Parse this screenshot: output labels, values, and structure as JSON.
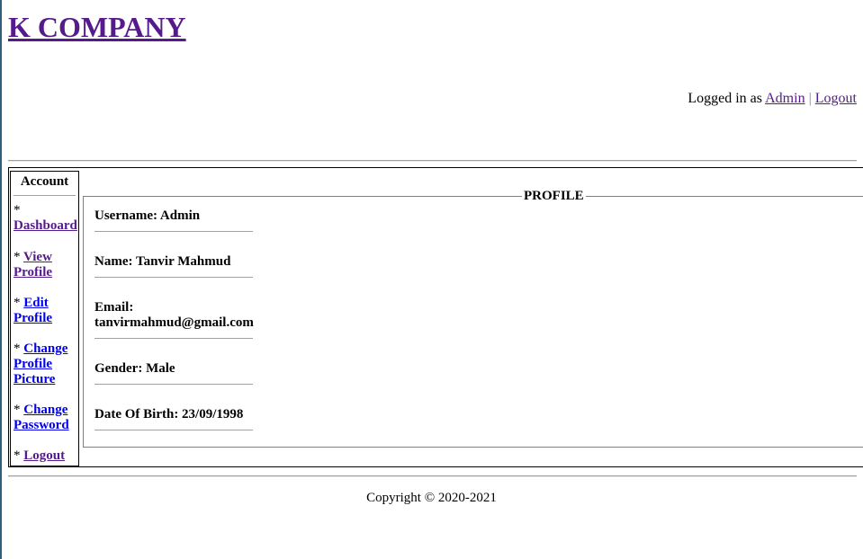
{
  "header": {
    "brand": "K COMPANY",
    "logged_in_prefix": "Logged in as",
    "user_link": "Admin",
    "separator": "|",
    "logout_link": "Logout"
  },
  "sidebar": {
    "title": "Account",
    "bullet": "*",
    "items": [
      {
        "label": "Dashboard"
      },
      {
        "label": "View Profile"
      },
      {
        "label": "Edit Profile"
      },
      {
        "label": "Change Profile Picture"
      },
      {
        "label": "Change Password"
      },
      {
        "label": "Logout"
      }
    ]
  },
  "profile": {
    "legend": "PROFILE",
    "fields": [
      {
        "text": "Username: Admin"
      },
      {
        "text": "Name: Tanvir Mahmud"
      },
      {
        "text": "Email: tanvirmahmud@gmail.com"
      },
      {
        "text": "Gender: Male"
      },
      {
        "text": "Date Of Birth: 23/09/1998"
      }
    ]
  },
  "footer": {
    "copyright": "Copyright © 2020-2021"
  },
  "colors": {
    "visited_link": "#551a8b",
    "link": "#0000ee"
  }
}
